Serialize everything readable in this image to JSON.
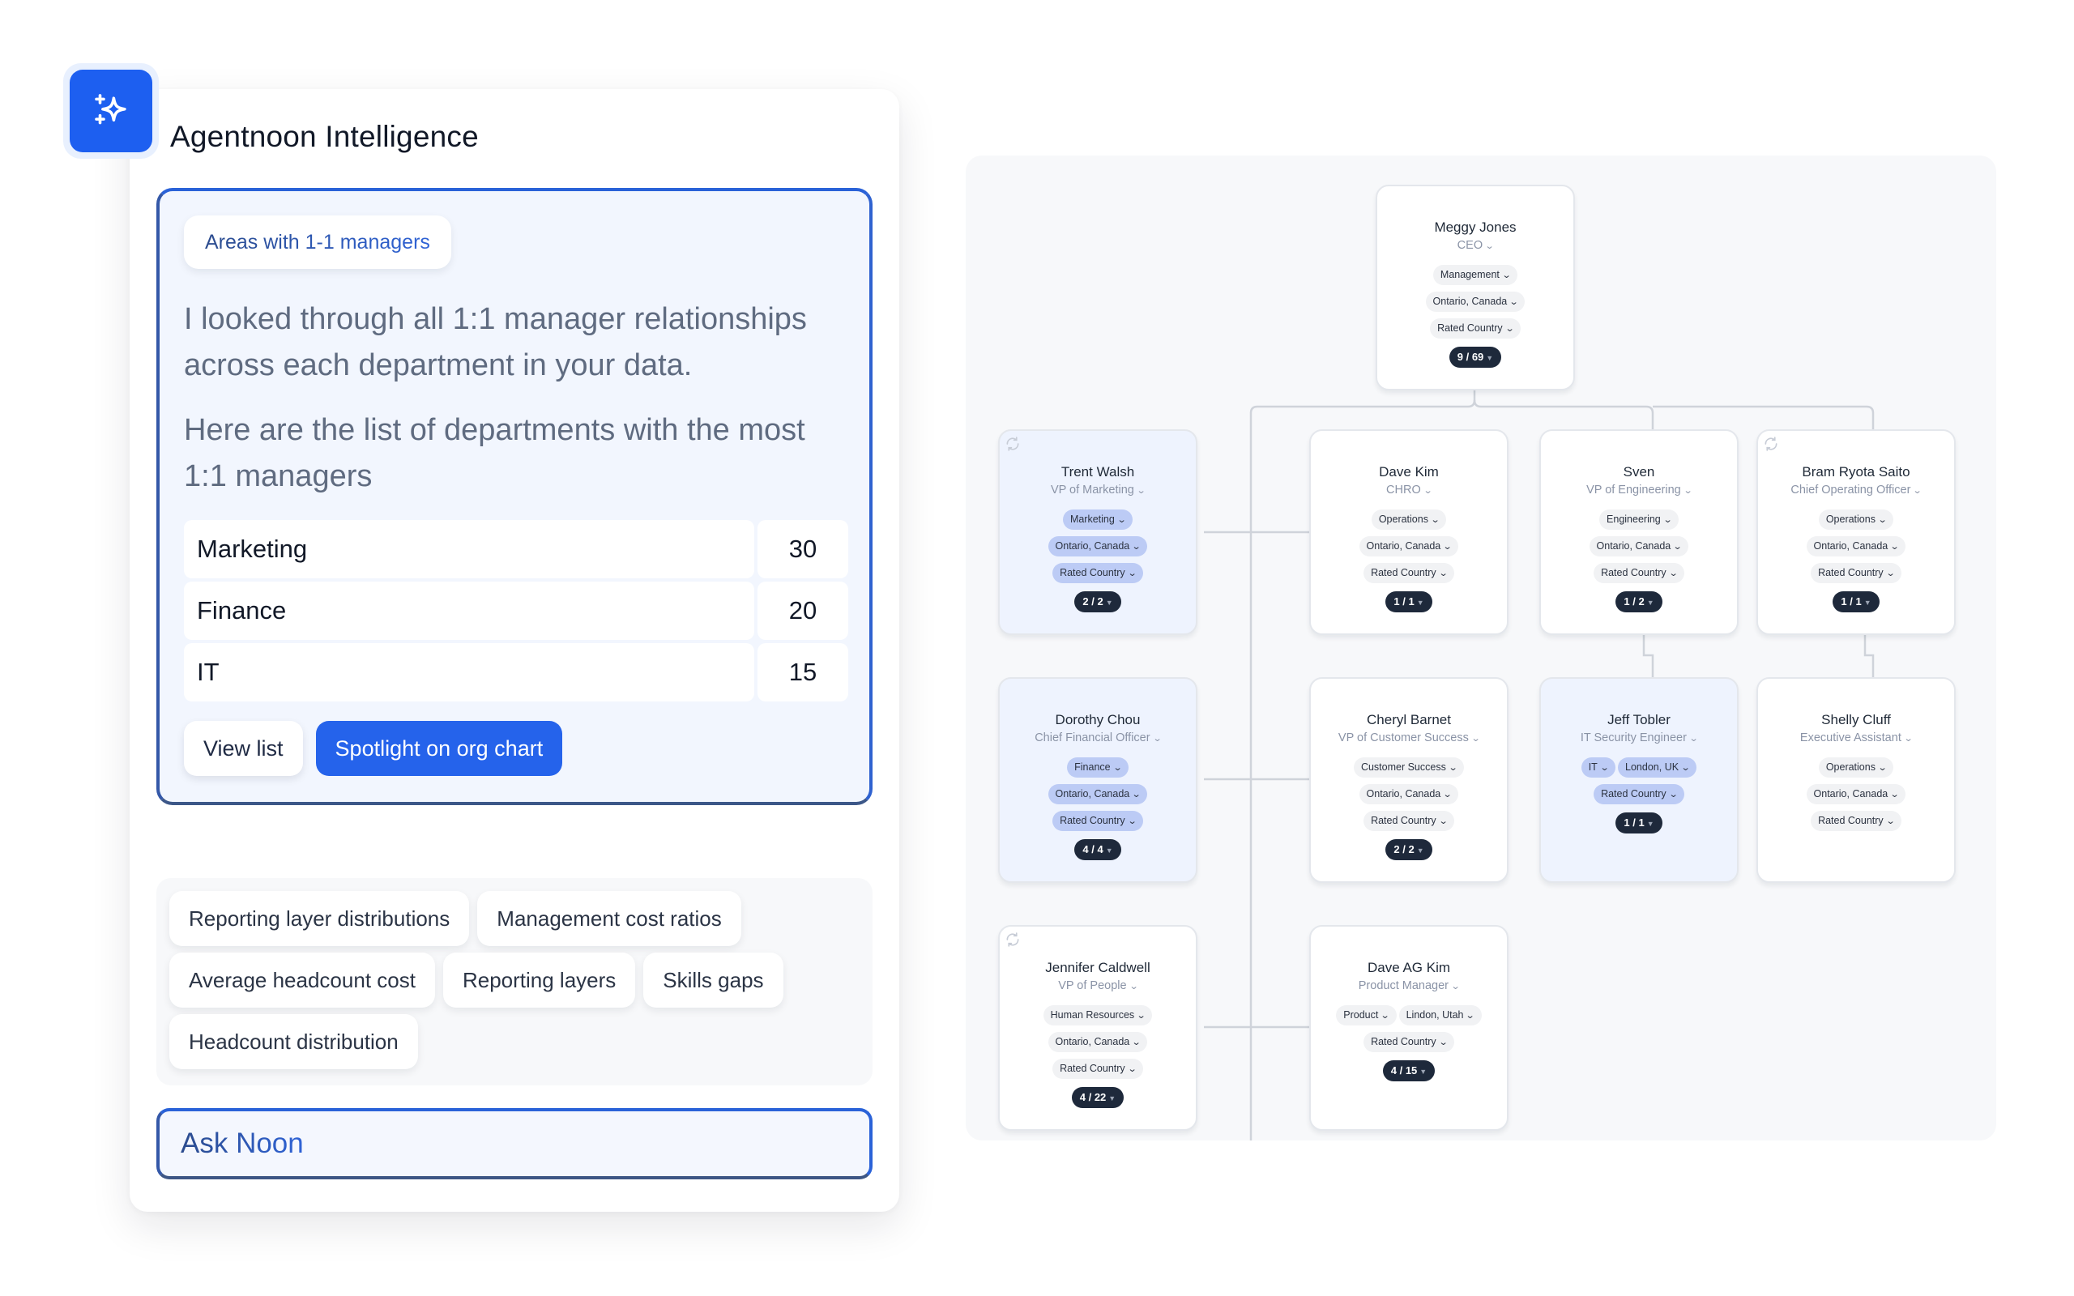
{
  "app": {
    "title": "Agentnoon Intelligence",
    "logo_icon": "sparkles-icon",
    "accent_color": "#2563eb"
  },
  "answer": {
    "query": "Areas with 1-1 managers",
    "paragraphs": [
      "I looked through all 1:1 manager relationships across each department in your data.",
      "Here are the list of departments with the most 1:1 managers"
    ],
    "departments": [
      {
        "name": "Marketing",
        "value": "30"
      },
      {
        "name": "Finance",
        "value": "20"
      },
      {
        "name": "IT",
        "value": "15"
      }
    ],
    "actions": {
      "view_list": "View list",
      "spotlight": "Spotlight on org chart"
    }
  },
  "suggestions": [
    "Reporting layer distributions",
    "Management cost ratios",
    "Average headcount cost",
    "Reporting layers",
    "Skills gaps",
    "Headcount distribution"
  ],
  "ask": {
    "placeholder": "Ask Noon"
  },
  "org_chart": {
    "nodes": [
      {
        "id": "ceo",
        "name": "Meggy Jones",
        "role": "CEO",
        "tags": [
          "Management",
          "Ontario, Canada",
          "Rated Country"
        ],
        "count": "9 / 69",
        "highlighted": false,
        "refresh": false
      },
      {
        "id": "trent",
        "name": "Trent Walsh",
        "role": "VP of Marketing",
        "tags": [
          "Marketing",
          "Ontario, Canada",
          "Rated Country"
        ],
        "count": "2 / 2",
        "highlighted": true,
        "refresh": true
      },
      {
        "id": "davekim",
        "name": "Dave Kim",
        "role": "CHRO",
        "tags": [
          "Operations",
          "Ontario, Canada",
          "Rated Country"
        ],
        "count": "1 / 1",
        "highlighted": false,
        "refresh": false
      },
      {
        "id": "sven",
        "name": "Sven",
        "role": "VP of Engineering",
        "tags": [
          "Engineering",
          "Ontario, Canada",
          "Rated Country"
        ],
        "count": "1 / 2",
        "highlighted": false,
        "refresh": false
      },
      {
        "id": "bram",
        "name": "Bram Ryota Saito",
        "role": "Chief Operating Officer",
        "tags": [
          "Operations",
          "Ontario, Canada",
          "Rated Country"
        ],
        "count": "1 / 1",
        "highlighted": false,
        "refresh": true
      },
      {
        "id": "dorothy",
        "name": "Dorothy Chou",
        "role": "Chief Financial Officer",
        "tags": [
          "Finance",
          "Ontario, Canada",
          "Rated Country"
        ],
        "count": "4 / 4",
        "highlighted": true,
        "refresh": false
      },
      {
        "id": "cheryl",
        "name": "Cheryl Barnet",
        "role": "VP of Customer Success",
        "tags": [
          "Customer Success",
          "Ontario, Canada",
          "Rated Country"
        ],
        "count": "2 / 2",
        "highlighted": false,
        "refresh": false
      },
      {
        "id": "jeff",
        "name": "Jeff Tobler",
        "role": "IT Security Engineer",
        "tags": [
          "IT",
          "London, UK",
          "Rated Country"
        ],
        "count": "1 / 1",
        "highlighted": true,
        "refresh": false
      },
      {
        "id": "shelly",
        "name": "Shelly Cluff",
        "role": "Executive Assistant",
        "tags": [
          "Operations",
          "Ontario, Canada",
          "Rated Country"
        ],
        "count": "",
        "highlighted": false,
        "refresh": false
      },
      {
        "id": "jennifer",
        "name": "Jennifer Caldwell",
        "role": "VP of People",
        "tags": [
          "Human Resources",
          "Ontario, Canada",
          "Rated Country"
        ],
        "count": "4 / 22",
        "highlighted": false,
        "refresh": true
      },
      {
        "id": "daveag",
        "name": "Dave AG Kim",
        "role": "Product Manager",
        "tags": [
          "Product",
          "Lindon, Utah",
          "Rated Country"
        ],
        "count": "4 / 15",
        "highlighted": false,
        "refresh": false
      }
    ]
  }
}
